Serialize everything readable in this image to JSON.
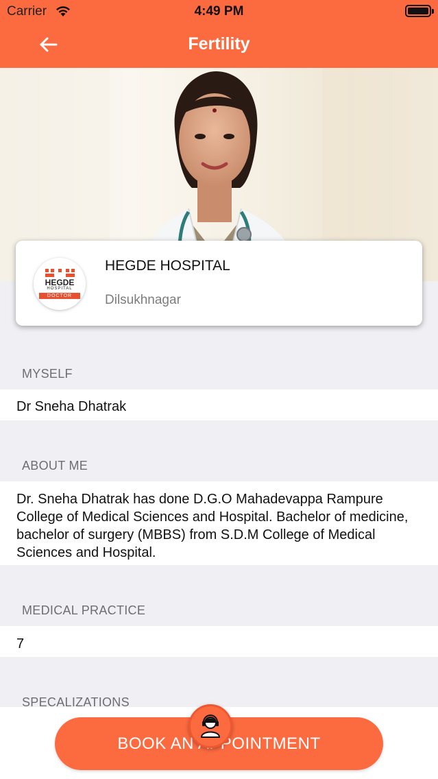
{
  "status": {
    "carrier": "Carrier",
    "time": "4:49 PM"
  },
  "nav": {
    "title": "Fertility"
  },
  "hospital": {
    "name": "HEGDE HOSPITAL",
    "location": "Dilsukhnagar",
    "logo_text": "HEGDE",
    "logo_sub": "HOSPITAL",
    "logo_tag": "DOCTOR"
  },
  "sections": {
    "myself": {
      "heading": "MYSELF",
      "value": "Dr Sneha Dhatrak"
    },
    "about": {
      "heading": "ABOUT ME",
      "value": "Dr. Sneha Dhatrak has done D.G.O Mahadevappa Rampure College of Medical Sciences and Hospital. Bachelor of medicine, bachelor of surgery (MBBS) from S.D.M College of Medical Sciences and Hospital."
    },
    "practice": {
      "heading": "MEDICAL PRACTICE",
      "value": "7"
    },
    "specializations": {
      "heading": "SPECALIZATIONS"
    }
  },
  "actions": {
    "book_label": "BOOK AN APPOINTMENT"
  },
  "colors": {
    "accent": "#fc6a40",
    "background": "#efeff4",
    "muted_text": "#6d6d72"
  },
  "icons": {
    "back": "back-arrow-icon",
    "wifi": "wifi-icon",
    "battery": "battery-icon",
    "support": "support-agent-icon"
  }
}
